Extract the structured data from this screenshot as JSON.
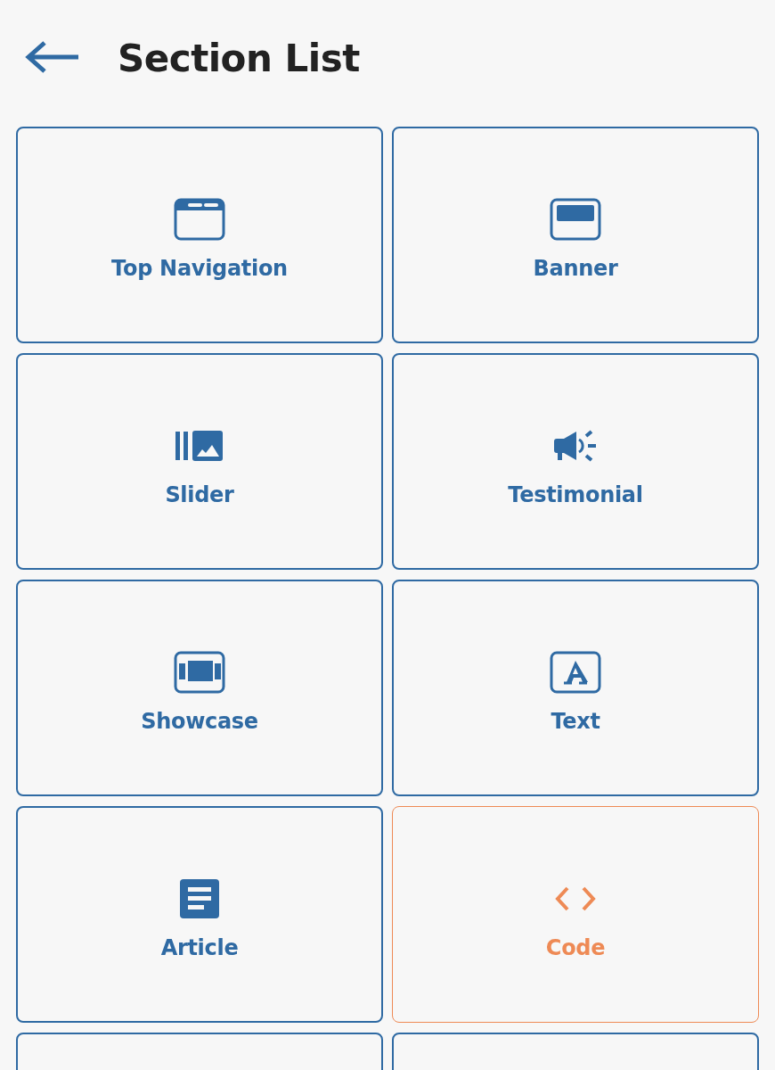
{
  "header": {
    "title": "Section List"
  },
  "sections": [
    {
      "label": "Top Navigation",
      "kind": "browser",
      "selected": false
    },
    {
      "label": "Banner",
      "kind": "banner",
      "selected": false
    },
    {
      "label": "Slider",
      "kind": "slider",
      "selected": false
    },
    {
      "label": "Testimonial",
      "kind": "megaphone",
      "selected": false
    },
    {
      "label": "Showcase",
      "kind": "showcase",
      "selected": false
    },
    {
      "label": "Text",
      "kind": "text",
      "selected": false
    },
    {
      "label": "Article",
      "kind": "article",
      "selected": false
    },
    {
      "label": "Code",
      "kind": "code",
      "selected": true
    },
    {
      "selected": false
    },
    {
      "selected": false
    }
  ]
}
